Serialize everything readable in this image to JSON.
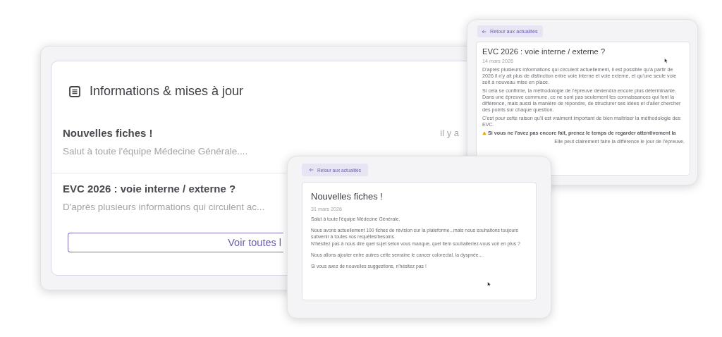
{
  "overview": {
    "title": "Informations & mises à jour",
    "items": [
      {
        "title": "Nouvelles fiches !",
        "snippet": "Salut à toute l'équipe Médecine Générale....",
        "time": "il y a"
      },
      {
        "title": "EVC 2026 : voie interne / externe ?",
        "snippet": "D'après plusieurs informations qui circulent ac..."
      }
    ],
    "button": "Voir toutes l"
  },
  "article_windows": [
    {
      "back": "Retour aux actualités",
      "title": "EVC 2026 : voie interne / externe ?",
      "date": "14 mars 2026",
      "paragraphs": [
        {
          "kind": "text",
          "text": "D'après plusieurs informations qui circulent actuellement, il est possible qu'à partir de 2026 il n'y ait plus de distinction entre voie interne et voie externe, et qu'une seule voie soit à nouveau mise en place."
        },
        {
          "kind": "text",
          "text": "Si cela se confirme, la méthodologie de l'épreuve deviendra encore plus déterminante. Dans une épreuve commune, ce ne sont pas seulement les connaissances qui font la différence, mais aussi la manière de répondre, de structurer ses idées et d'aller chercher des points sur chaque question."
        },
        {
          "kind": "text",
          "text": "C'est pour cette raison qu'il est vraiment important de bien maîtriser la méthodologie des EVC."
        },
        {
          "kind": "warning",
          "lead": "Si vous ne l'avez pas encore fait, prenez le temps de regarder attentivement la",
          "tail": "Elle peut clairement faire la différence le jour de l'épreuve."
        }
      ]
    },
    {
      "back": "Retour aux actualités",
      "title": "Nouvelles fiches !",
      "date": "31 mars 2026",
      "paragraphs": [
        {
          "kind": "text",
          "text": "Salut à toute l'équipe Médecine Générale."
        },
        {
          "kind": "text",
          "text": "Nous avons actuellement 100 fiches de révision sur la plateforme...mais nous souhaitons toujours subvenir à toutes vos requêtes/besoins.\nN'hésitez pas à nous dire quel sujet selon vous manque, quel item souhaiteriez-vous voir en plus ?"
        },
        {
          "kind": "text",
          "text": "Nous allons ajouter entre autres cette semaine le cancer colorectal, la dyspnée..."
        },
        {
          "kind": "text",
          "text": "Si vous avez de nouvelles suggestions, n'hésitez pas !"
        }
      ]
    }
  ]
}
